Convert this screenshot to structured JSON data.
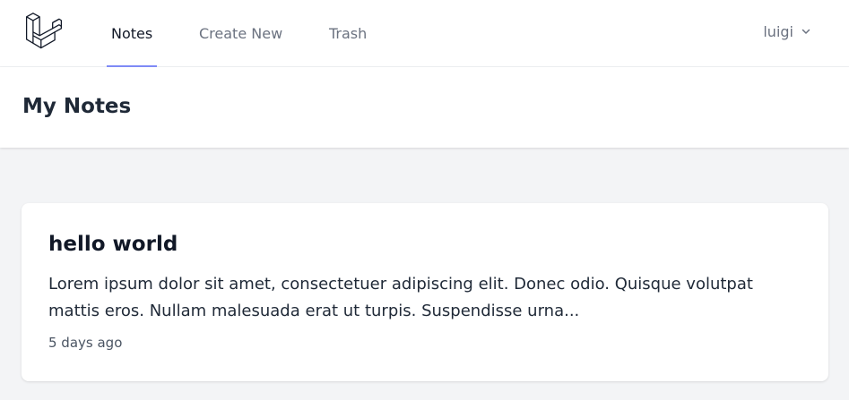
{
  "nav": {
    "links": [
      {
        "label": "Notes",
        "active": true
      },
      {
        "label": "Create New",
        "active": false
      },
      {
        "label": "Trash",
        "active": false
      }
    ],
    "user": {
      "name": "luigi"
    }
  },
  "header": {
    "title": "My Notes"
  },
  "notes": [
    {
      "title": "hello world",
      "excerpt": "Lorem ipsum dolor sit amet, consectetuer adipiscing elit. Donec odio. Quisque volutpat mattis eros. Nullam malesuada erat ut turpis. Suspendisse urna...",
      "time": "5 days ago"
    }
  ],
  "colors": {
    "accent": "#818cf8",
    "background": "#f3f4f6",
    "surface": "#ffffff"
  },
  "icons": {
    "logo": "laravel-logo-icon",
    "user_menu": "chevron-down-icon"
  }
}
